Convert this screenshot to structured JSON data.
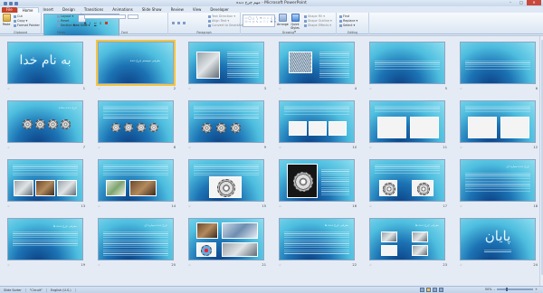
{
  "window": {
    "title": "مهم چرخ دنده - Microsoft PowerPoint",
    "min": "–",
    "max": "□",
    "close": "✕"
  },
  "tabs": [
    "File",
    "Home",
    "Insert",
    "Design",
    "Transitions",
    "Animations",
    "Slide Show",
    "Review",
    "View",
    "Developer"
  ],
  "ribbon": {
    "clipboard": {
      "paste": "Paste",
      "cut": "Cut",
      "copy": "Copy ▾",
      "format_painter": "Format Painter",
      "label": "Clipboard"
    },
    "slides": {
      "new_slide": "New Slide ▾",
      "layout": "Layout ▾",
      "reset": "Reset",
      "section": "Section ▾",
      "label": "Slides"
    },
    "font": {
      "font_name": "",
      "font_size": "",
      "label": "Font"
    },
    "paragraph": {
      "text_direction": "Text Direction ▾",
      "align_text": "Align Text ▾",
      "convert_smartart": "Convert to SmartArt ▾",
      "label": "Paragraph"
    },
    "drawing": {
      "arrange": "Arrange",
      "quick_styles": "Quick Styles ▾",
      "shape_fill": "Shape Fill ▾",
      "shape_outline": "Shape Outline ▾",
      "shape_effects": "Shape Effects ▾",
      "label": "Drawing"
    },
    "editing": {
      "find": "Find",
      "replace": "Replace ▾",
      "select": "Select ▾",
      "label": "Editing"
    }
  },
  "slides": [
    {
      "n": "1",
      "title": "به نام خدا"
    },
    {
      "n": "2",
      "title": "معرفی سیستم چرخ دنده"
    },
    {
      "n": "3"
    },
    {
      "n": "4"
    },
    {
      "n": "5"
    },
    {
      "n": "6",
      "title": "چرخ دنده ساده"
    },
    {
      "n": "7"
    },
    {
      "n": "8"
    },
    {
      "n": "9"
    },
    {
      "n": "10"
    },
    {
      "n": "11"
    },
    {
      "n": "12"
    },
    {
      "n": "13"
    },
    {
      "n": "14"
    },
    {
      "n": "15"
    },
    {
      "n": "16"
    },
    {
      "n": "17"
    },
    {
      "n": "18"
    },
    {
      "n": "19"
    },
    {
      "n": "20",
      "title": "چرخ دنده سیاره ای"
    },
    {
      "n": "21",
      "title": "معرفی چرخ دنده ها"
    },
    {
      "n": "22"
    },
    {
      "n": "23"
    },
    {
      "n": "24"
    },
    {
      "n": "25"
    },
    {
      "n": "26",
      "title": "پایان"
    }
  ],
  "slide_star": "☆",
  "status": {
    "slide_sorter": "Slide Sorter",
    "theme": "\"Circuit\"",
    "language": "English (U.S.)",
    "zoom": "50%",
    "zoom_minus": "–",
    "zoom_plus": "+"
  }
}
